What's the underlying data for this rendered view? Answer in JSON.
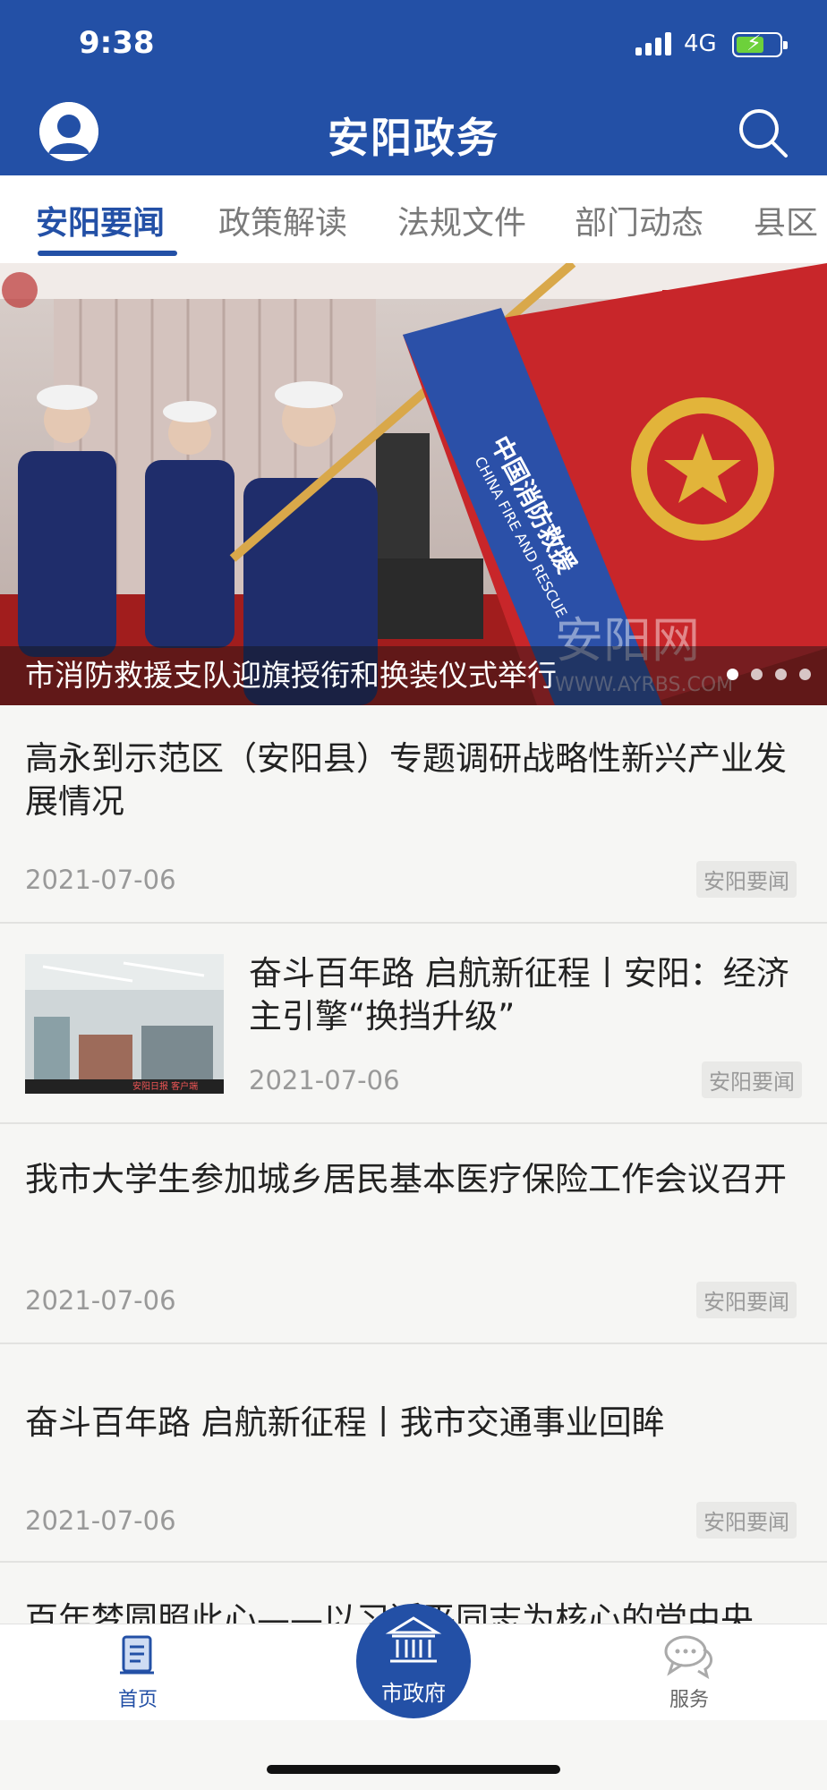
{
  "status_bar": {
    "time": "9:38",
    "network": "4G"
  },
  "header": {
    "title": "安阳政务"
  },
  "tabs": [
    {
      "label": "安阳要闻",
      "active": true
    },
    {
      "label": "政策解读",
      "active": false
    },
    {
      "label": "法规文件",
      "active": false
    },
    {
      "label": "部门动态",
      "active": false
    },
    {
      "label": "县区",
      "active": false
    }
  ],
  "banner": {
    "caption": "市消防救援支队迎旗授衔和换装仪式举行",
    "flag_text": "中国消防救援",
    "flag_text_en": "CHINA FIRE AND RESCUE",
    "watermark": "安阳网",
    "watermark_url": "WWW.AYRBS.COM"
  },
  "news": [
    {
      "title": "高永到示范区（安阳县）专题调研战略性新兴产业发展情况",
      "date": "2021-07-06",
      "tag": "安阳要闻"
    },
    {
      "title": "奋斗百年路 启航新征程丨安阳：经济主引擎“换挡升级”",
      "date": "2021-07-06",
      "tag": "安阳要闻",
      "thumb_caption": "安阳日报 客户端"
    },
    {
      "title": "我市大学生参加城乡居民基本医疗保险工作会议召开",
      "date": "2021-07-06",
      "tag": "安阳要闻"
    },
    {
      "title": "奋斗百年路 启航新征程丨我市交通事业回眸",
      "date": "2021-07-06",
      "tag": "安阳要闻"
    },
    {
      "title": "百年梦圆照此心——以习近平同志为核心的党中央",
      "date": "",
      "tag": ""
    }
  ],
  "bottom_nav": {
    "home": "首页",
    "center": "市政府",
    "service": "服务"
  },
  "colors": {
    "brand": "#2350a6",
    "tab_active": "#2350a6"
  },
  "icons": [
    "user-avatar-icon",
    "search-icon",
    "home-doc-icon",
    "government-building-icon",
    "chat-bubbles-icon"
  ]
}
